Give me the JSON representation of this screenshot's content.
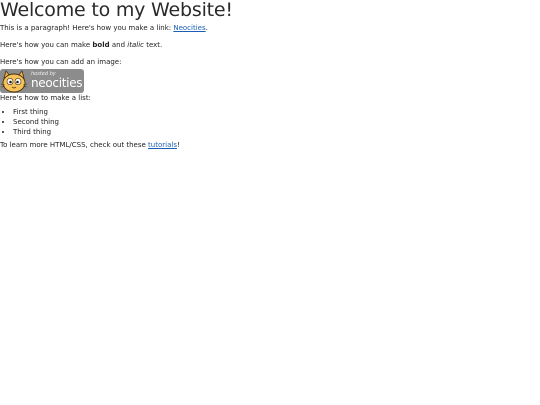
{
  "heading": "Welcome to my Website!",
  "paragraph1": {
    "text": "This is a paragraph! Here's how you make a link: ",
    "link_label": "Neocities",
    "after": "."
  },
  "paragraph2": {
    "before": "Here's how you can make ",
    "bold": "bold",
    "middle": " and ",
    "italic": "italic",
    "after": " text."
  },
  "paragraph3": "Here's how you can add an image:",
  "badge": {
    "small_text": "hosted by",
    "big_text": "neocities",
    "icon": "neocities-cat-icon",
    "background": "#8c8c8c"
  },
  "paragraph4": "Here's how to make a list:",
  "list": [
    "First thing",
    "Second thing",
    "Third thing"
  ],
  "paragraph5": {
    "before": "To learn more HTML/CSS, check out these ",
    "link_label": "tutorials",
    "after": "!"
  },
  "colors": {
    "link": "#1a5fb4",
    "text": "#222222"
  }
}
